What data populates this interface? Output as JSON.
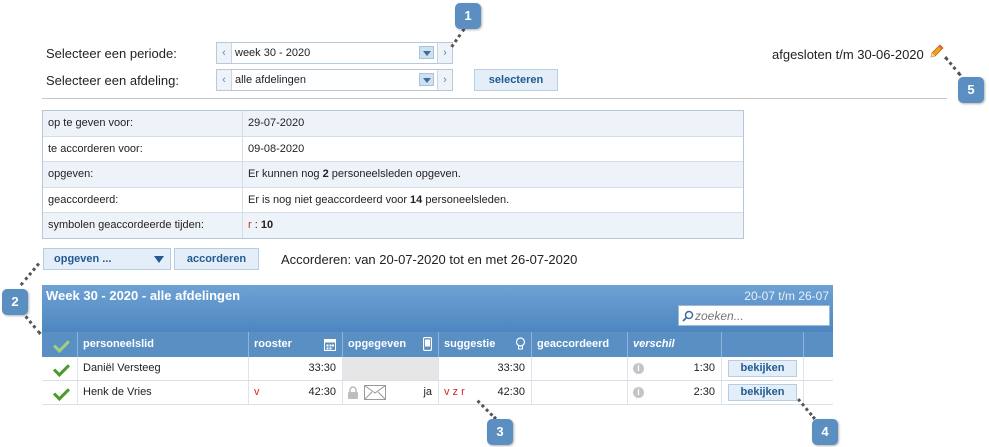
{
  "filters": {
    "period_label": "Selecteer een periode:",
    "period_value": "week 30 - 2020",
    "department_label": "Selecteer een afdeling:",
    "department_value": "alle afdelingen",
    "select_button": "selecteren",
    "closed_text": "afgesloten t/m 30-06-2020"
  },
  "info": [
    {
      "key": "op te geven voor:",
      "value": "29-07-2020"
    },
    {
      "key": "te accorderen voor:",
      "value": "09-08-2020"
    },
    {
      "key": "opgeven:",
      "pre": "Er kunnen nog ",
      "bold": "2",
      "post": " personeelsleden opgeven."
    },
    {
      "key": "geaccordeerd:",
      "pre": "Er is nog niet geaccordeerd voor ",
      "bold": "14",
      "post": " personeelsleden."
    },
    {
      "key": "symbolen geaccordeerde tijden:",
      "sym": "r",
      "sep": " : ",
      "bold": "10"
    }
  ],
  "actions": {
    "opgeven_button": "opgeven ...",
    "accorderen_button": "accorderen",
    "range_text": "Accorderen: van 20-07-2020 tot en met 26-07-2020"
  },
  "grid": {
    "title": "Week 30 - 2020 - alle afdelingen",
    "range": "20-07 t/m 26-07",
    "search_placeholder": "zoeken...",
    "columns": {
      "employee": "personeelslid",
      "roster": "rooster",
      "submitted": "opgegeven",
      "suggestion": "suggestie",
      "approved": "geaccordeerd",
      "difference": "verschil"
    },
    "rows": [
      {
        "name": "Daniël Versteeg",
        "roster_flag": "",
        "roster": "33:30",
        "submitted_flag": "",
        "suggest_flags": "",
        "suggestion": "33:30",
        "difference": "1:30",
        "view": "bekijken"
      },
      {
        "name": "Henk de Vries",
        "roster_flag": "v",
        "roster": "42:30",
        "submitted_flag": "ja",
        "suggest_flags": "v z r",
        "suggestion": "42:30",
        "difference": "2:30",
        "view": "bekijken"
      }
    ]
  },
  "badges": {
    "b1": "1",
    "b2": "2",
    "b3": "3",
    "b4": "4",
    "b5": "5"
  },
  "icons": [
    "pencil-icon",
    "calendar-icon",
    "phone-icon",
    "lightbulb-icon",
    "search-icon",
    "checkmark-icon",
    "lock-icon",
    "envelope-icon",
    "info-icon"
  ],
  "colors": {
    "accent": "#5a8fc4",
    "badge": "#5b8fc2",
    "flag_red": "#d22222",
    "check_green": "#4a9a2a"
  }
}
